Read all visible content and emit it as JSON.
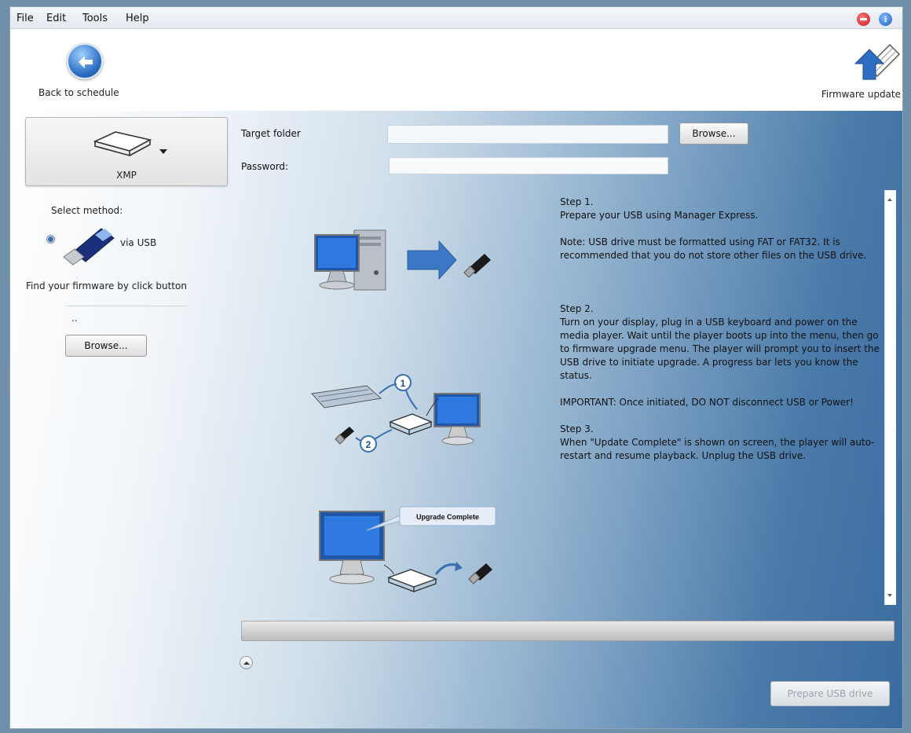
{
  "menu": {
    "items": [
      "File",
      "Edit",
      "Tools",
      "Help"
    ]
  },
  "title_icons": {
    "stop": "stop-icon",
    "info": "info-icon",
    "info_glyph": "i"
  },
  "toolbar": {
    "back_label": "Back to schedule",
    "firmware_label": "Firmware update"
  },
  "sidebar": {
    "device_label": "XMP",
    "select_method": "Select method:",
    "method_label": "via USB",
    "find_firmware": "Find your firmware by click button",
    "firmware_path": "..",
    "browse_label": "Browse..."
  },
  "form": {
    "target_folder_label": "Target folder",
    "target_folder_value": "",
    "password_label": "Password:",
    "password_value": "",
    "browse_label": "Browse..."
  },
  "steps": {
    "step1_title": "Step 1.",
    "step1_text": "Prepare your USB using Manager Express.",
    "step1_note": "Note: USB drive must be formatted using FAT or FAT32. It is recommended that you do not store other files on the USB drive.",
    "step2_title": "Step 2.",
    "step2_text": "Turn on your display, plug in a USB keyboard and power on the media player. Wait until the player boots up into the menu, then go to firmware upgrade menu. The player will prompt you to insert the USB drive to initiate upgrade. A progress bar lets you know the status.",
    "step2_important": "IMPORTANT: Once initiated, DO NOT disconnect USB or Power!",
    "step3_title": "Step 3.",
    "step3_text": "When \"Update Complete\" is shown on screen, the player will auto-restart and resume playback. Unplug the USB drive."
  },
  "illustrations": {
    "callout_1": "1",
    "callout_2": "2",
    "upgrade_complete": "Upgrade Complete"
  },
  "progress": {
    "value": 0
  },
  "footer": {
    "prepare_label": "Prepare USB drive"
  }
}
